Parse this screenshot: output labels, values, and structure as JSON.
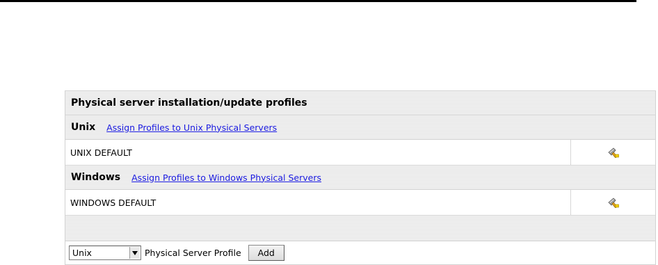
{
  "panel": {
    "title": "Physical server installation/update profiles",
    "groups": [
      {
        "name": "Unix",
        "link": "Assign Profiles to Unix Physical Servers",
        "profiles": [
          {
            "name": "UNIX DEFAULT",
            "action_icon": "edit-hammer-icon"
          }
        ]
      },
      {
        "name": "Windows",
        "link": "Assign Profiles to Windows Physical Servers",
        "profiles": [
          {
            "name": "WINDOWS DEFAULT",
            "action_icon": "edit-hammer-icon"
          }
        ]
      }
    ]
  },
  "footer": {
    "os_select": {
      "selected": "Unix"
    },
    "label": "Physical Server Profile",
    "add_label": "Add"
  },
  "colors": {
    "link": "#1a1adf",
    "header_bg": "#ececec",
    "border": "#d2d2d2"
  }
}
